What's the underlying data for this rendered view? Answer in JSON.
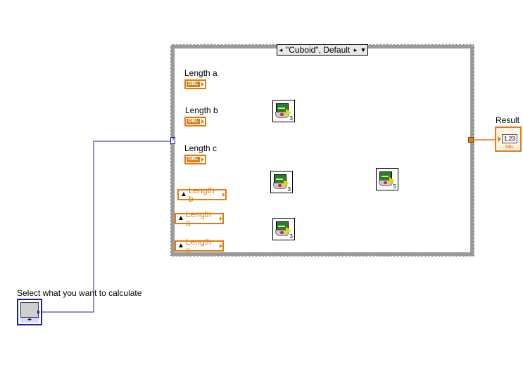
{
  "case_structure": {
    "selector_value": "\"Cuboid\", Default",
    "left_arrow": "◂",
    "right_arrow": "▸",
    "dropdown": "▼",
    "selector_tunnel_glyph": "?"
  },
  "controls": {
    "length_a": {
      "label": "Length a",
      "type_badge": "DBL"
    },
    "length_b": {
      "label": "Length b",
      "type_badge": "DBL"
    },
    "length_c": {
      "label": "Length c",
      "type_badge": "DBL"
    }
  },
  "local_variables": [
    {
      "label": "Length b"
    },
    {
      "label": "Length a"
    },
    {
      "label": "Length c"
    }
  ],
  "subvis": [
    {
      "name": "multiply-subvi-1",
      "number": "3"
    },
    {
      "name": "multiply-subvi-2",
      "number": "3"
    },
    {
      "name": "multiply-subvi-3",
      "number": "3"
    },
    {
      "name": "sum-subvi",
      "number": "5"
    }
  ],
  "result": {
    "label": "Result",
    "display": "1.23",
    "type_badge": "DBL"
  },
  "selector_control": {
    "label": "Select what you want to calculate",
    "arrows": "◂▸"
  },
  "colors": {
    "double_wire": "#e07c10",
    "enum_wire": "#1c1c9e",
    "case_frame": "#9a9a9a"
  }
}
